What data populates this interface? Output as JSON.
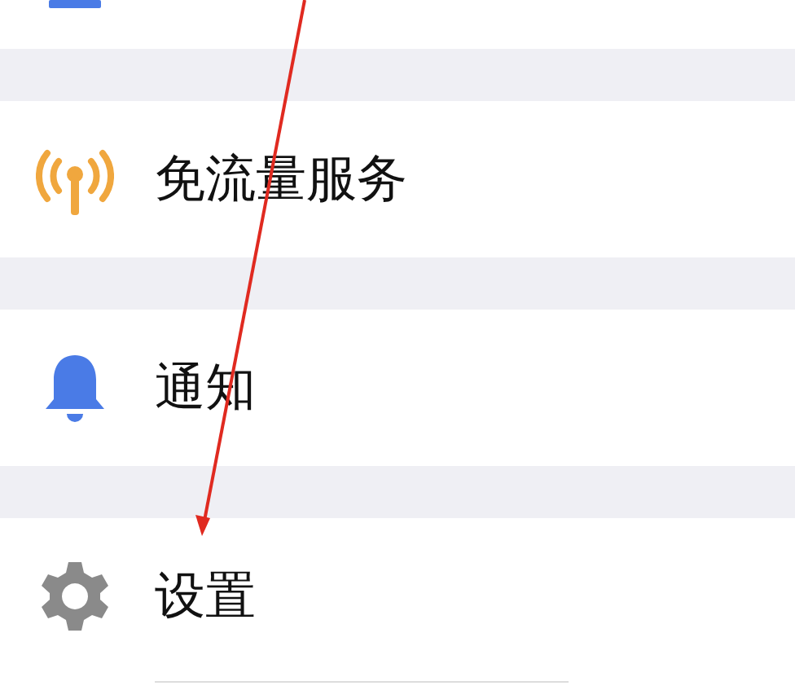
{
  "items": [
    {
      "kind": "partial"
    },
    {
      "kind": "antenna",
      "label": "免流量服务"
    },
    {
      "kind": "bell",
      "label": "通知"
    },
    {
      "kind": "gear",
      "label": "设置"
    }
  ]
}
